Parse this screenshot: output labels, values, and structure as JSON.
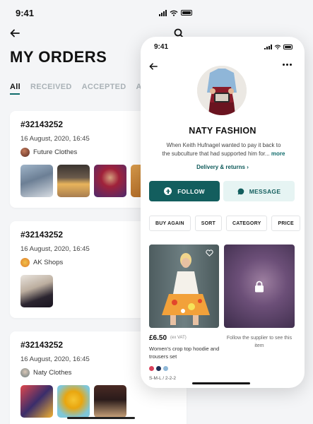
{
  "back_screen": {
    "status_time": "9:41",
    "title": "MY ORDERS",
    "tabs": [
      {
        "label": "All",
        "active": true
      },
      {
        "label": "RECEIVED",
        "active": false
      },
      {
        "label": "ACCEPTED",
        "active": false
      },
      {
        "label": "AME",
        "active": false
      }
    ],
    "orders": [
      {
        "id": "#32143252",
        "date": "16 August, 2020, 16:45",
        "shop": "Future Clothes",
        "cut_text": "£"
      },
      {
        "id": "#32143252",
        "date": "16 August, 2020, 16:45",
        "shop": "AK Shops"
      },
      {
        "id": "#32143252",
        "date": "16 August, 2020, 16:45",
        "shop": "Naty Clothes"
      }
    ]
  },
  "front_screen": {
    "status_time": "9:41",
    "shop_name": "NATY FASHION",
    "description": "When Keith Hufnagel wanted to pay it back to the subculture that had supported him for...",
    "more_label": "more",
    "delivery_link": "Delivery & returns",
    "follow_label": "FOLLOW",
    "message_label": "MESSAGE",
    "filters": [
      "BUY AGAIN",
      "SORT",
      "CATEGORY",
      "PRICE"
    ],
    "product": {
      "price": "£6.50",
      "vat": "(ex VAT)",
      "name": "Women's crop top hoodie and trousers set",
      "sizes": "S-M-L / 2-2-2",
      "swatch_colors": [
        "#d9415b",
        "#1c2e55",
        "#8fb8d8"
      ]
    },
    "locked_note": "Follow the supplier to see this item"
  },
  "colors": {
    "accent": "#135e5e",
    "accent_light": "#e6f4f3",
    "tab_inactive": "#aab2b7"
  }
}
